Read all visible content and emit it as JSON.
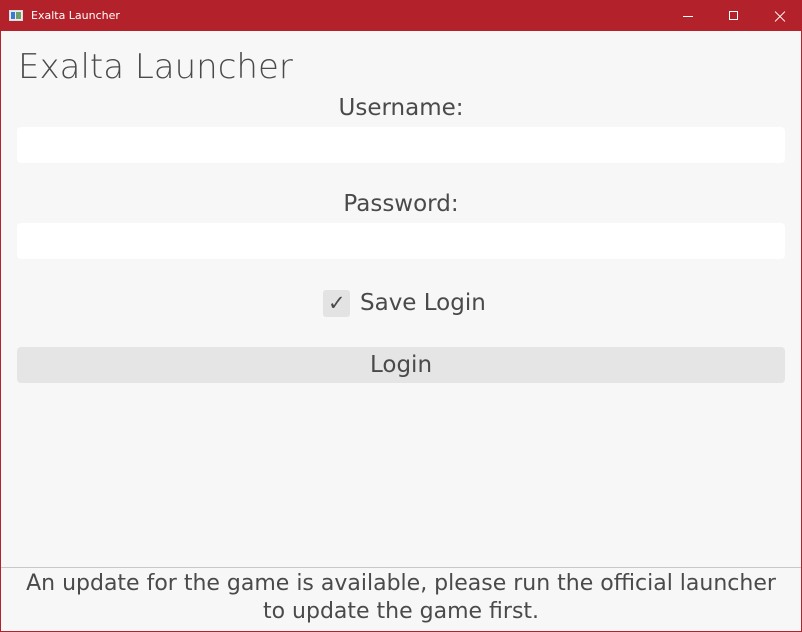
{
  "window": {
    "title": "Exalta Launcher",
    "accent_color": "#b3222a",
    "icons": {
      "app": "app-icon",
      "minimize": "minimize-icon",
      "maximize": "maximize-icon",
      "close": "close-icon"
    }
  },
  "app": {
    "title": "Exalta Launcher"
  },
  "form": {
    "username_label": "Username:",
    "username_value": "",
    "password_label": "Password:",
    "password_value": "",
    "save_login_label": "Save Login",
    "save_login_checked": true,
    "check_glyph": "✓",
    "login_button_label": "Login"
  },
  "status": {
    "line1": "An update for the game is available, please run the official launcher",
    "line2": "to update the game first."
  }
}
